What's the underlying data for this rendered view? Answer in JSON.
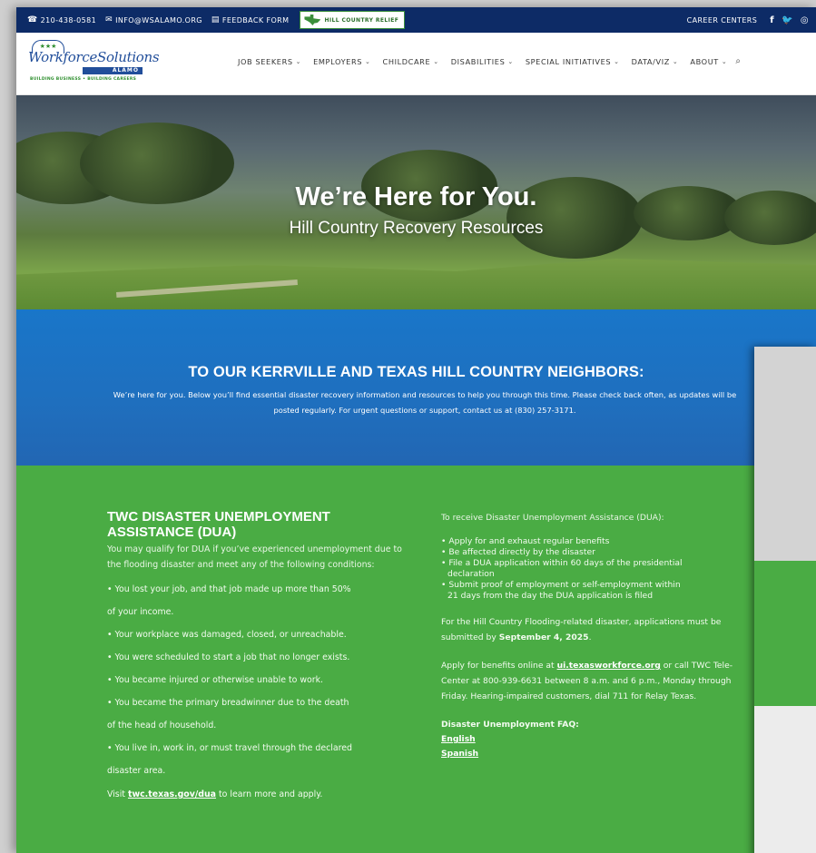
{
  "topbar": {
    "phone": "210-438-0581",
    "email": "INFO@WSALAMO.ORG",
    "feedback": "FEEDBACK FORM",
    "relief_button": "HILL COUNTRY RELIEF",
    "career_centers": "CAREER CENTERS",
    "social_icons": [
      "facebook-icon",
      "twitter-icon",
      "instagram-icon"
    ]
  },
  "logo": {
    "name": "WorkforceSolutions",
    "sub": "ALAMO",
    "tagline": "BUILDING BUSINESS • BUILDING CAREERS"
  },
  "nav": {
    "items": [
      {
        "label": "JOB SEEKERS"
      },
      {
        "label": "EMPLOYERS"
      },
      {
        "label": "CHILDCARE"
      },
      {
        "label": "DISABILITIES"
      },
      {
        "label": "SPECIAL INITIATIVES"
      },
      {
        "label": "DATA/VIZ"
      },
      {
        "label": "ABOUT"
      }
    ]
  },
  "hero": {
    "title": "We’re Here for You.",
    "subtitle": "Hill Country Recovery Resources"
  },
  "notice": {
    "heading": "TO OUR KERRVILLE AND TEXAS HILL COUNTRY NEIGHBORS:",
    "body": "We’re here for you. Below you’ll find essential disaster recovery information and resources to help you through this time. Please check back often, as updates will be posted regularly. For urgent questions or support, contact us at (830) 257-3171."
  },
  "dua": {
    "heading": "TWC DISASTER UNEMPLOYMENT ASSISTANCE (DUA)",
    "intro": "You may qualify for DUA if you’ve experienced unemployment due to the flooding disaster and meet any of the following conditions:",
    "conditions": [
      "• You lost your job, and that job made up more than 50%",
      "of your income.",
      "• Your workplace was damaged, closed, or unreachable.",
      "• You were scheduled to start a job that no longer exists.",
      "• You became injured or otherwise unable to work.",
      "• You became the primary breadwinner due to the death",
      "of the head of household.",
      "• You live in, work in, or must travel through the declared",
      "disaster area."
    ],
    "visit_prefix": "Visit ",
    "visit_link": "twc.texas.gov/dua",
    "visit_suffix": " to learn more and apply.",
    "receive_lead": "To receive Disaster Unemployment Assistance (DUA):",
    "requirements": [
      "• Apply for and exhaust regular benefits",
      "• Be affected directly by the disaster",
      "• File a DUA application within 60 days of the presidential",
      "   declaration",
      "• Submit proof of employment or self-employment within",
      "   21 days from the day the DUA application is filed"
    ],
    "deadline_prefix": "For the Hill Country Flooding-related disaster, applications must be submitted by ",
    "deadline_date": "September 4, 2025",
    "deadline_suffix": ".",
    "apply_prefix": "Apply for benefits online at ",
    "apply_link": "ui.texasworkforce.org",
    "apply_suffix": " or call TWC Tele-Center at 800-939-6631 between 8 a.m. and 6 p.m., Monday through Friday. Hearing-impaired customers, dial 711 for Relay Texas.",
    "faq_title": "Disaster Unemployment FAQ:",
    "faq_links": [
      "English",
      "Spanish"
    ]
  }
}
